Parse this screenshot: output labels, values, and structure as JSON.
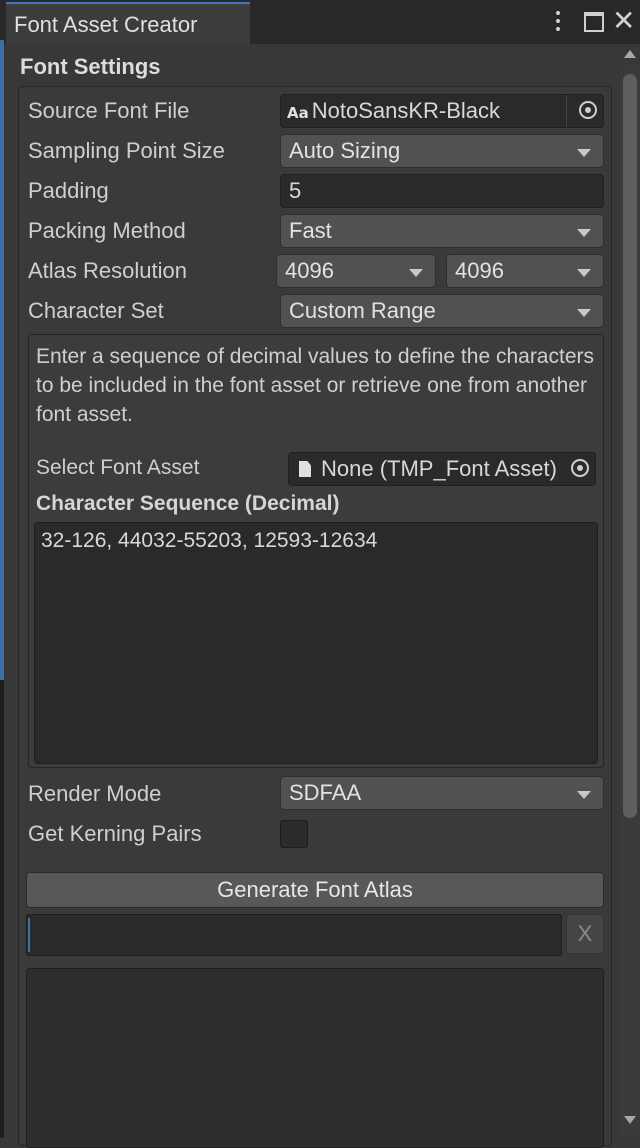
{
  "window": {
    "tab_title": "Font Asset Creator"
  },
  "section": {
    "title": "Font Settings"
  },
  "fields": {
    "source_font_file": {
      "label": "Source Font File",
      "value": "NotoSansKR-Black",
      "icon_text": "Aa"
    },
    "sampling_point_size": {
      "label": "Sampling Point Size",
      "value": "Auto Sizing"
    },
    "padding": {
      "label": "Padding",
      "value": "5"
    },
    "packing_method": {
      "label": "Packing Method",
      "value": "Fast"
    },
    "atlas_resolution": {
      "label": "Atlas Resolution",
      "width": "4096",
      "height": "4096"
    },
    "character_set": {
      "label": "Character Set",
      "value": "Custom Range"
    }
  },
  "custom_range": {
    "help_text": "Enter a sequence of decimal values to define the characters to be included in the font asset or retrieve one from another font asset.",
    "select_font_asset": {
      "label": "Select Font Asset",
      "value": "None (TMP_Font Asset)"
    },
    "sequence_label": "Character Sequence (Decimal)",
    "sequence_value": "32-126, 44032-55203, 12593-12634"
  },
  "render_mode": {
    "label": "Render Mode",
    "value": "SDFAA"
  },
  "get_kerning_pairs": {
    "label": "Get Kerning Pairs",
    "checked": false
  },
  "generate_button": {
    "label": "Generate Font Atlas"
  },
  "progress_cancel": {
    "label": "X"
  },
  "progress": {
    "fraction": 0
  },
  "colors": {
    "background": "#383838",
    "field": "#2a2a2a",
    "dropdown": "#515151",
    "accent": "#3d6fa8"
  },
  "icons": [
    "menu-dots-icon",
    "maximize-icon",
    "close-icon",
    "font-file-icon",
    "object-picker-icon",
    "document-icon",
    "dropdown-caret-icon"
  ]
}
